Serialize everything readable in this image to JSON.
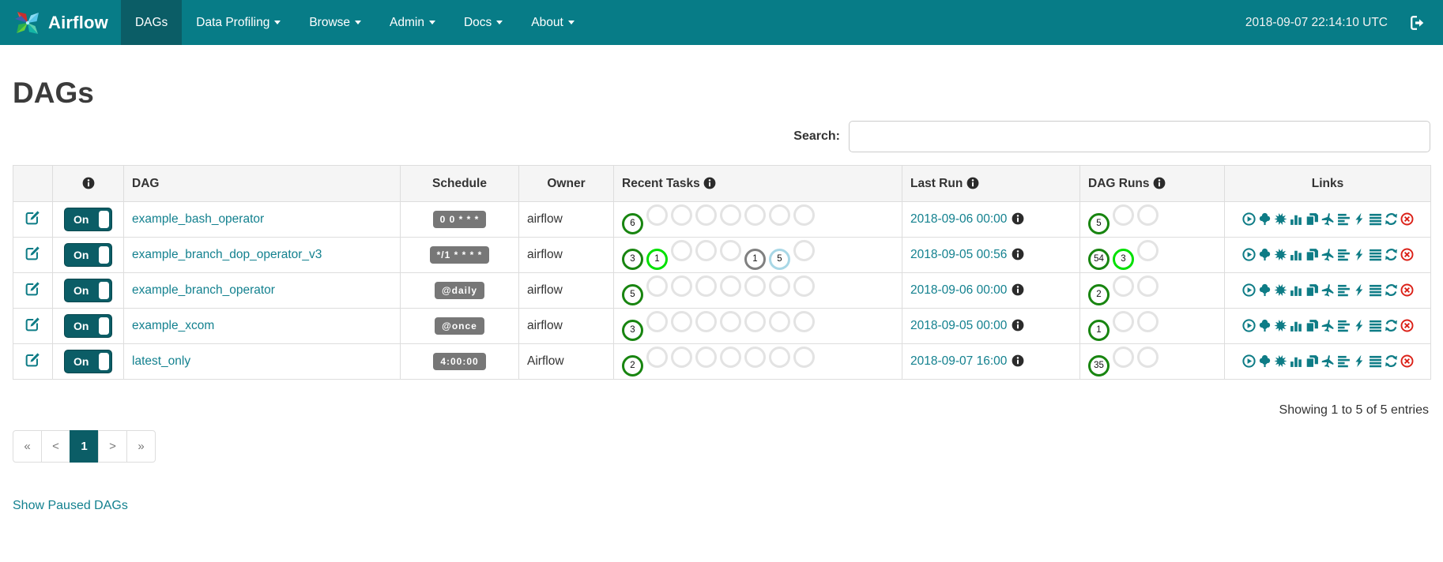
{
  "navbar": {
    "brand": "Airflow",
    "items": [
      {
        "label": "DAGs",
        "active": true,
        "caret": false
      },
      {
        "label": "Data Profiling",
        "active": false,
        "caret": true
      },
      {
        "label": "Browse",
        "active": false,
        "caret": true
      },
      {
        "label": "Admin",
        "active": false,
        "caret": true
      },
      {
        "label": "Docs",
        "active": false,
        "caret": true
      },
      {
        "label": "About",
        "active": false,
        "caret": true
      }
    ],
    "clock": "2018-09-07 22:14:10 UTC",
    "signout_icon": "sign-out-icon"
  },
  "page": {
    "title": "DAGs"
  },
  "search": {
    "label": "Search:",
    "value": ""
  },
  "colors": {
    "accent_teal": "#0E7C86",
    "navbar": "#077C87",
    "navbar_active": "#0B5D66",
    "link": "#13818F",
    "delete_red": "#DB2118",
    "states": {
      "success": "#188510",
      "running": "#00E000",
      "queued": "#808080",
      "none": "#A8D7E6",
      "empty": "#e3e3e3"
    }
  },
  "table": {
    "headers": {
      "edit": "",
      "toggle_info_icon": "info-icon",
      "dag": "DAG",
      "schedule": "Schedule",
      "owner": "Owner",
      "recent_tasks": "Recent Tasks",
      "last_run": "Last Run",
      "dag_runs": "DAG Runs",
      "links": "Links"
    },
    "toggle_on_label": "On",
    "links_icons": [
      {
        "name": "trigger-dag-icon",
        "symbol": "i-play"
      },
      {
        "name": "tree-view-icon",
        "symbol": "i-tree"
      },
      {
        "name": "graph-view-icon",
        "symbol": "i-burst"
      },
      {
        "name": "task-duration-icon",
        "symbol": "i-bars"
      },
      {
        "name": "task-tries-icon",
        "symbol": "i-copy"
      },
      {
        "name": "landing-times-icon",
        "symbol": "i-plane"
      },
      {
        "name": "gantt-view-icon",
        "symbol": "i-alignleft"
      },
      {
        "name": "code-view-icon",
        "symbol": "i-flash"
      },
      {
        "name": "dag-details-icon",
        "symbol": "i-alignjustify"
      },
      {
        "name": "refresh-icon",
        "symbol": "i-refresh"
      },
      {
        "name": "delete-dag-icon",
        "symbol": "i-removecircle",
        "danger": true
      }
    ],
    "rows": [
      {
        "dag": "example_bash_operator",
        "schedule": "0 0 * * *",
        "owner": "airflow",
        "recent_tasks": [
          {
            "count": "6",
            "state": "success"
          },
          {},
          {},
          {},
          {},
          {},
          {},
          {}
        ],
        "last_run": "2018-09-06 00:00",
        "dag_runs": [
          {
            "count": "5",
            "state": "success"
          },
          {},
          {}
        ]
      },
      {
        "dag": "example_branch_dop_operator_v3",
        "schedule": "*/1 * * * *",
        "owner": "airflow",
        "recent_tasks": [
          {
            "count": "3",
            "state": "success"
          },
          {
            "count": "1",
            "state": "running"
          },
          {},
          {},
          {},
          {
            "count": "1",
            "state": "queued"
          },
          {
            "count": "5",
            "state": "none"
          },
          {}
        ],
        "last_run": "2018-09-05 00:56",
        "dag_runs": [
          {
            "count": "54",
            "state": "success"
          },
          {
            "count": "3",
            "state": "running"
          },
          {}
        ]
      },
      {
        "dag": "example_branch_operator",
        "schedule": "@daily",
        "owner": "airflow",
        "recent_tasks": [
          {
            "count": "5",
            "state": "success"
          },
          {},
          {},
          {},
          {},
          {},
          {},
          {}
        ],
        "last_run": "2018-09-06 00:00",
        "dag_runs": [
          {
            "count": "2",
            "state": "success"
          },
          {},
          {}
        ]
      },
      {
        "dag": "example_xcom",
        "schedule": "@once",
        "owner": "airflow",
        "recent_tasks": [
          {
            "count": "3",
            "state": "success"
          },
          {},
          {},
          {},
          {},
          {},
          {},
          {}
        ],
        "last_run": "2018-09-05 00:00",
        "dag_runs": [
          {
            "count": "1",
            "state": "success"
          },
          {},
          {}
        ]
      },
      {
        "dag": "latest_only",
        "schedule": "4:00:00",
        "owner": "Airflow",
        "recent_tasks": [
          {
            "count": "2",
            "state": "success"
          },
          {},
          {},
          {},
          {},
          {},
          {},
          {}
        ],
        "last_run": "2018-09-07 16:00",
        "dag_runs": [
          {
            "count": "35",
            "state": "success"
          },
          {},
          {}
        ]
      }
    ]
  },
  "footer": {
    "showing": "Showing 1 to 5 of 5 entries",
    "pagination": [
      {
        "label": "«"
      },
      {
        "label": "<"
      },
      {
        "label": "1",
        "active": true
      },
      {
        "label": ">"
      },
      {
        "label": "»"
      }
    ],
    "show_paused": "Show Paused DAGs"
  }
}
